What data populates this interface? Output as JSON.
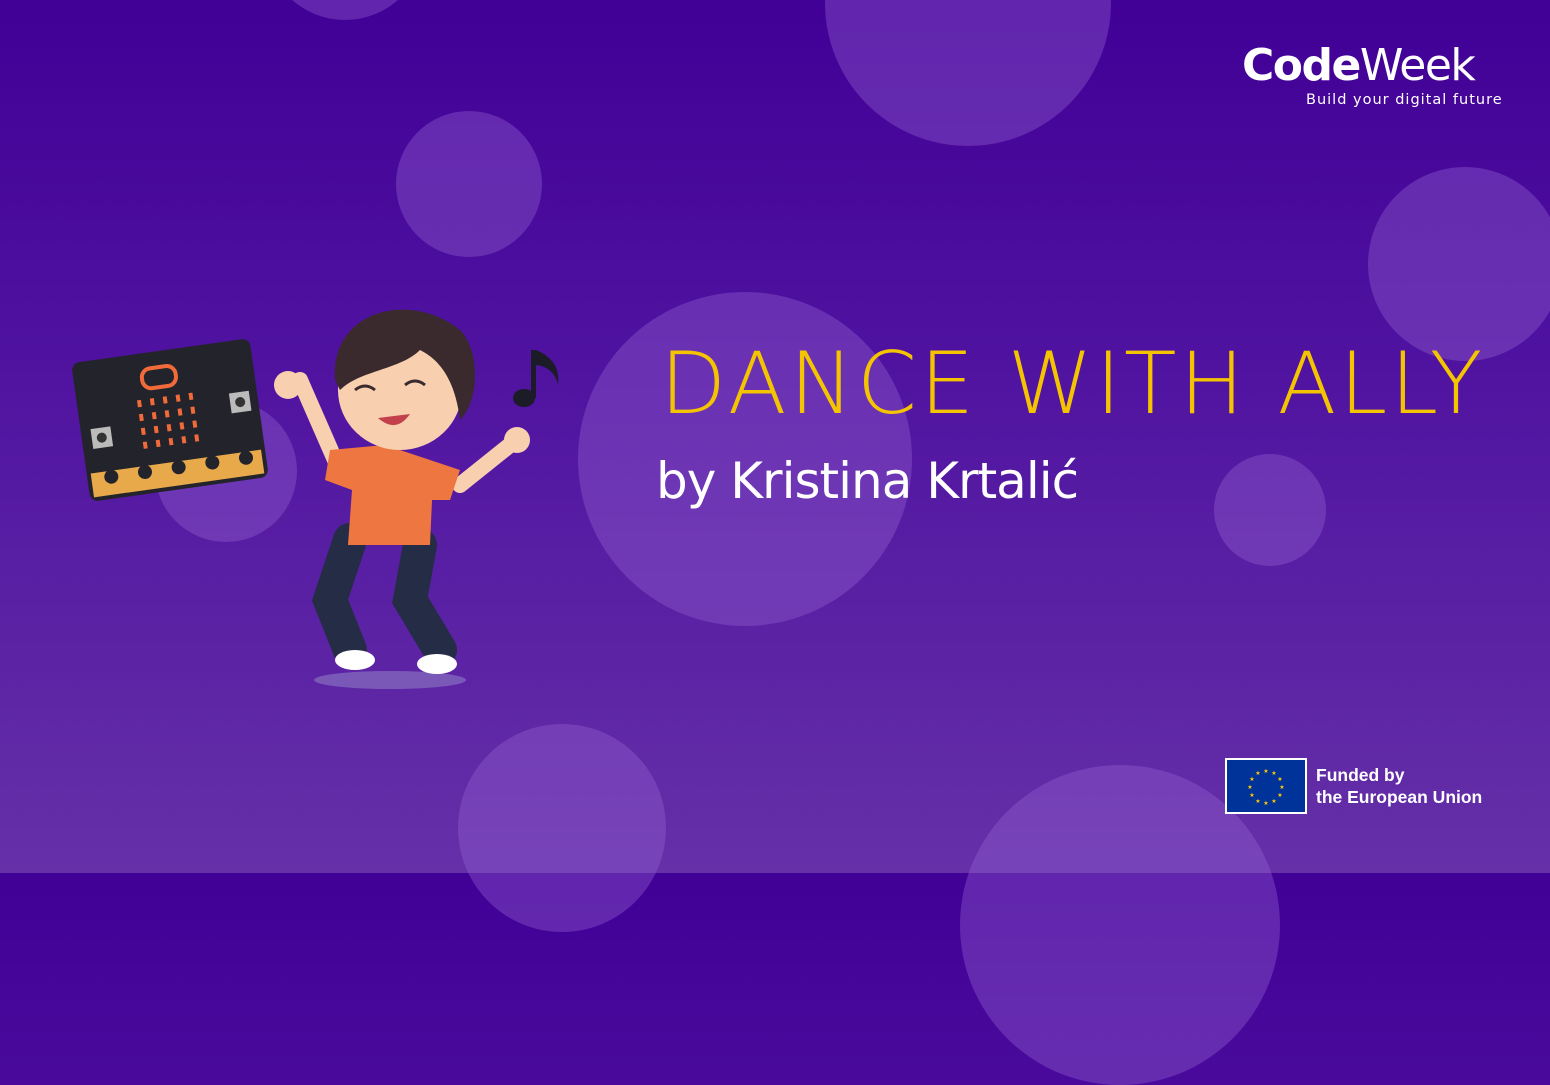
{
  "logo": {
    "brand_bold": "Code",
    "brand_light": "Week",
    "tagline": "Build your digital future"
  },
  "slide": {
    "title": "DANCE WITH ALLY",
    "subtitle": "by Kristina Krtalić"
  },
  "funding": {
    "line1": "Funded by",
    "line2": "the European Union"
  },
  "colors": {
    "background_top": "#410096",
    "background_bottom": "#6530a8",
    "title": "#f5c400",
    "eu_blue": "#003399",
    "eu_star": "#ffcc00"
  }
}
